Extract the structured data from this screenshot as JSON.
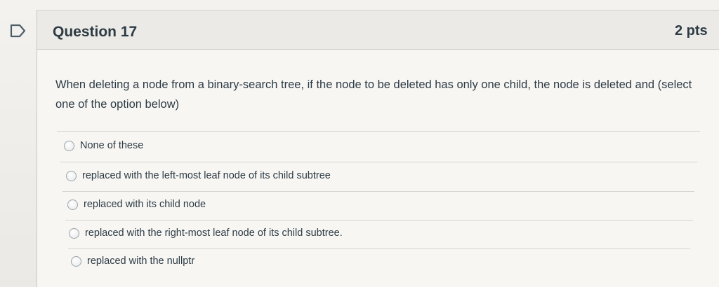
{
  "question": {
    "title": "Question 17",
    "points": "2 pts",
    "text": "When deleting a node from a binary-search tree, if the node to be deleted has only one child, the node is deleted and (select one of the option below)"
  },
  "answers": [
    {
      "label": "None of these"
    },
    {
      "label": "replaced with the left-most leaf node of its child subtree"
    },
    {
      "label": "replaced with its child node"
    },
    {
      "label": "replaced with the right-most leaf node of its child subtree."
    },
    {
      "label": "replaced with the nullptr"
    }
  ],
  "colors": {
    "text": "#2d3b45",
    "flag_outline": "#4f5d67"
  }
}
